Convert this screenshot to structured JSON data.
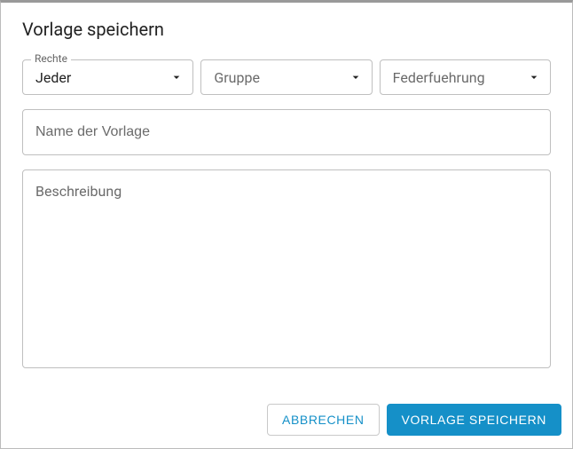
{
  "dialog": {
    "title": "Vorlage speichern"
  },
  "fields": {
    "rights": {
      "label": "Rechte",
      "value": "Jeder"
    },
    "group": {
      "placeholder": "Gruppe",
      "value": ""
    },
    "lead": {
      "placeholder": "Federfuehrung",
      "value": ""
    },
    "name": {
      "placeholder": "Name der Vorlage",
      "value": ""
    },
    "description": {
      "placeholder": "Beschreibung",
      "value": ""
    }
  },
  "actions": {
    "cancel": "Abbrechen",
    "save": "Vorlage speichern"
  }
}
